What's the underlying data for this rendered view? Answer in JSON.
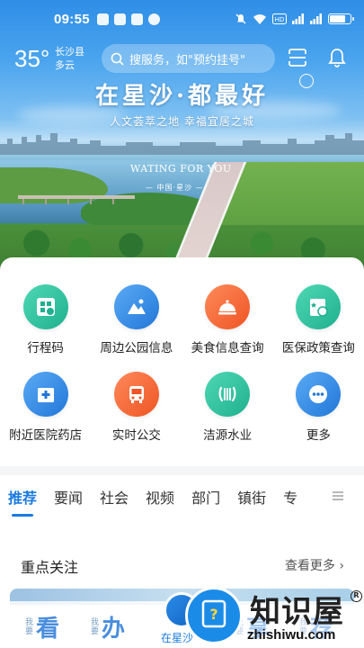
{
  "status_bar": {
    "time": "09:55",
    "battery_level": 0.78,
    "icons": [
      "notification-app-icons",
      "mute-icon",
      "wifi-icon",
      "hd-icon",
      "signal-5g-icon",
      "signal-4g-icon",
      "battery-icon"
    ]
  },
  "header": {
    "temperature": "35°",
    "location": "长沙县",
    "weather": "多云",
    "search_placeholder": "搜服务，如\"预约挂号\""
  },
  "hero": {
    "slogan": "在星沙·都最好",
    "tagline": "人文荟萃之地  幸福宜居之城",
    "subtitle_en": "WATING FOR YOU",
    "subtitle_cn": "— 中国·星沙 —"
  },
  "services": [
    {
      "label": "行程码",
      "icon": "itinerary-code-icon",
      "color": "#2bc4a0"
    },
    {
      "label": "周边公园信息",
      "icon": "park-icon",
      "color": "#2f8fe8"
    },
    {
      "label": "美食信息查询",
      "icon": "food-cloche-icon",
      "color": "#f2683a"
    },
    {
      "label": "医保政策查询",
      "icon": "medical-insurance-icon",
      "color": "#2bc4a0"
    },
    {
      "label": "附近医院药店",
      "icon": "hospital-icon",
      "color": "#2f8fe8"
    },
    {
      "label": "实时公交",
      "icon": "bus-icon",
      "color": "#f2683a"
    },
    {
      "label": "洁源水业",
      "icon": "water-utility-icon",
      "color": "#2bc4a0"
    },
    {
      "label": "更多",
      "icon": "more-icon",
      "color": "#2f8fe8"
    }
  ],
  "tabs": [
    "推荐",
    "要闻",
    "社会",
    "视频",
    "部门",
    "镇街",
    "专"
  ],
  "active_tab": "推荐",
  "focus": {
    "title": "重点关注",
    "more": "查看更多"
  },
  "bottom_nav": {
    "items": [
      {
        "small": "我要",
        "big": "看"
      },
      {
        "small": "我要",
        "big": "办"
      },
      {
        "label": "在星沙"
      },
      {
        "small": "我要",
        "big": "享"
      },
      {
        "small": "我要",
        "big": "荐"
      }
    ]
  },
  "watermark": {
    "text": "知识屋",
    "url": "zhishiwu.com",
    "reg": "R"
  },
  "colors": {
    "accent": "#1a7ae0",
    "teal": "#2bc4a0",
    "orange": "#f2683a",
    "blue": "#2f8fe8"
  }
}
